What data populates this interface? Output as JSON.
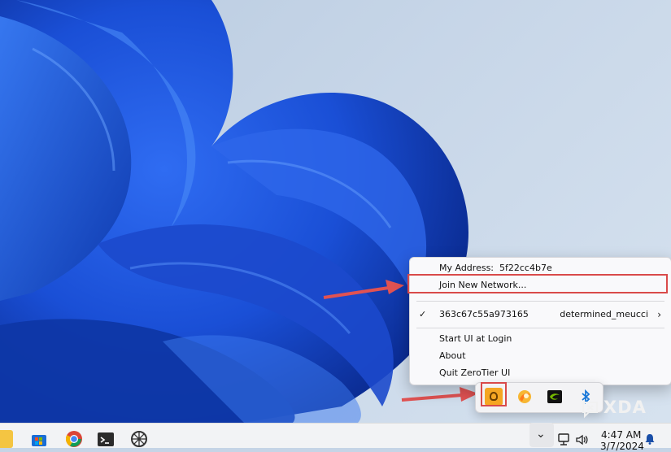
{
  "menu": {
    "address_label": "My Address:",
    "address_value": "5f22cc4b7e",
    "join_label": "Join New Network...",
    "network_check": "✓",
    "network_id": "363c67c55a973165",
    "network_name": "determined_meucci",
    "network_chevron": "›",
    "start_ui_label": "Start UI at Login",
    "about_label": "About",
    "quit_label": "Quit ZeroTier UI"
  },
  "tray_flyout": {
    "icons": [
      "zerotier-icon",
      "orange-app-icon",
      "nvidia-icon",
      "bluetooth-icon"
    ]
  },
  "taskbar": {
    "pinned_icons": [
      "file-explorer-icon",
      "microsoft-store-icon",
      "chrome-icon",
      "terminal-icon",
      "wheel-app-icon"
    ],
    "overflow_chevron": "⌄",
    "time": "4:47 AM",
    "date": "3/7/2024"
  },
  "watermark": {
    "text": "XDA"
  },
  "colors": {
    "highlight": "#d94a4a",
    "wallpaper_blue": "#1f55e0",
    "zerotier_orange": "#f5a623"
  }
}
